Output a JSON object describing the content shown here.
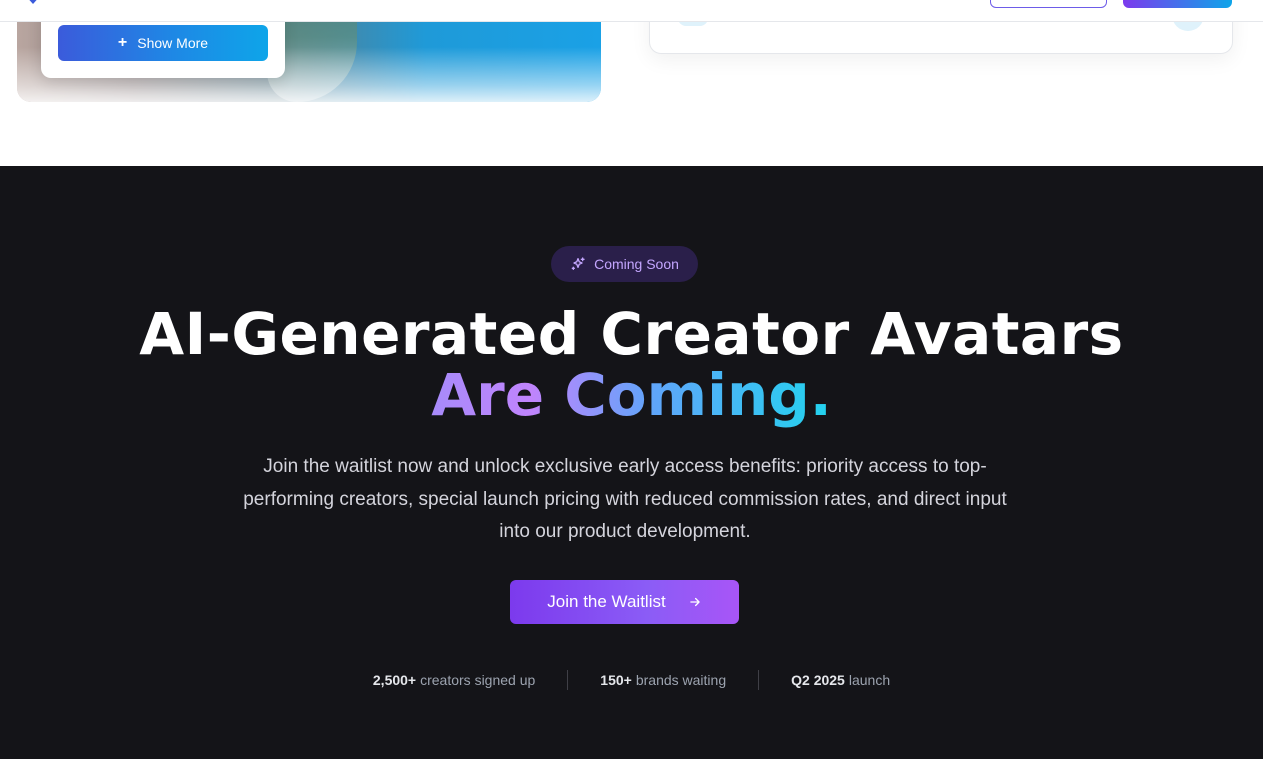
{
  "top": {
    "show_more_label": "Show More"
  },
  "colors": {
    "background_dark": "#141418",
    "accent_purple": "#7c3aed",
    "accent_cyan": "#22d3ee",
    "badge_text": "#c4a6ff"
  },
  "icons": {
    "plus": "plus-icon",
    "sparkle": "sparkle-icon",
    "arrow": "arrow-right-icon"
  },
  "badge": {
    "label": "Coming Soon"
  },
  "hero": {
    "title_line1": "AI-Generated Creator Avatars",
    "title_line2": "Are Coming.",
    "description": "Join the waitlist now and unlock exclusive early access benefits: priority access to top-performing creators, special launch pricing with reduced commission rates, and direct input into our product development."
  },
  "cta": {
    "label": "Join the Waitlist"
  },
  "stats": [
    {
      "value": "2,500+",
      "label": "creators signed up"
    },
    {
      "value": "150+",
      "label": "brands waiting"
    },
    {
      "value": "Q2 2025",
      "label": "launch"
    }
  ]
}
